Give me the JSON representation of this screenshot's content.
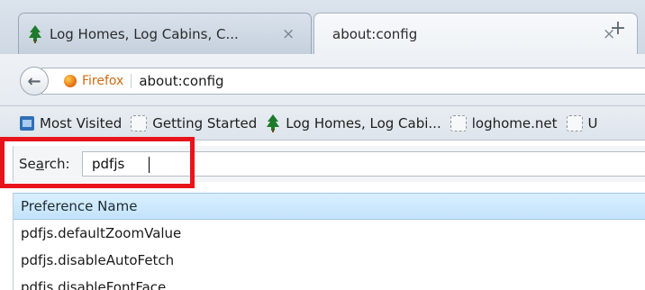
{
  "tabs": [
    {
      "title": "Log Homes, Log Cabins, C...",
      "close": "×",
      "active": false
    },
    {
      "title": "about:config",
      "close": "×",
      "active": true
    }
  ],
  "new_tab_label": "+",
  "nav": {
    "back_glyph": "←",
    "identity_label": "Firefox",
    "url": "about:config"
  },
  "bookmarks": [
    {
      "label": "Most Visited",
      "icon": "folder-icon"
    },
    {
      "label": "Getting Started",
      "icon": "page-icon"
    },
    {
      "label": "Log Homes, Log Cabi...",
      "icon": "tree-icon"
    },
    {
      "label": "loghome.net",
      "icon": "page-icon"
    },
    {
      "label": "U",
      "icon": "page-icon"
    }
  ],
  "search": {
    "label_before": "Se",
    "label_access": "a",
    "label_after": "rch:",
    "value": "pdfjs"
  },
  "table": {
    "header": "Preference Name",
    "rows": [
      "pdfjs.defaultZoomValue",
      "pdfjs.disableAutoFetch",
      "pdfjs.disableFontFace"
    ]
  },
  "colors": {
    "highlight": "#e8141c",
    "header_bg": "#c2e3fb",
    "identity": "#d06b12"
  }
}
